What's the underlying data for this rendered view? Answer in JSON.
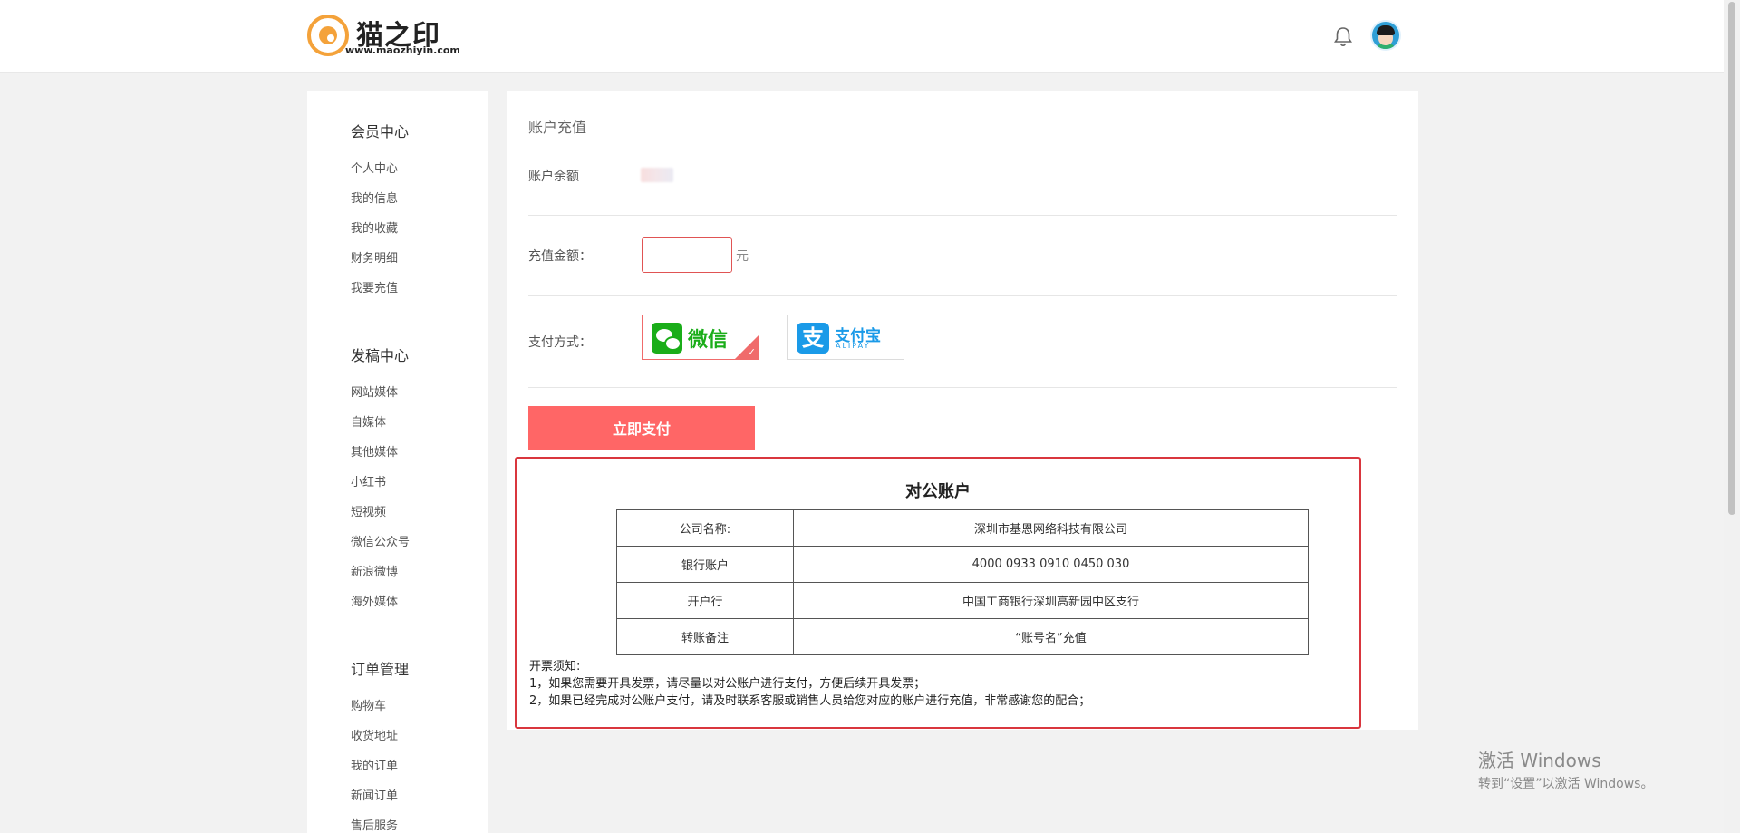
{
  "header": {
    "logo_title": "猫之印",
    "logo_url": "www.maozhiyin.com",
    "bell_icon": "bell-icon",
    "avatar_icon": "user-avatar"
  },
  "sidebar": {
    "groups": [
      {
        "title": "会员中心",
        "items": [
          "个人中心",
          "我的信息",
          "我的收藏",
          "财务明细",
          "我要充值"
        ]
      },
      {
        "title": "发稿中心",
        "items": [
          "网站媒体",
          "自媒体",
          "其他媒体",
          "小红书",
          "短视频",
          "微信公众号",
          "新浪微博",
          "海外媒体"
        ]
      },
      {
        "title": "订单管理",
        "items": [
          "购物车",
          "收货地址",
          "我的订单",
          "新闻订单",
          "售后服务"
        ]
      }
    ]
  },
  "recharge": {
    "title": "账户充值",
    "balance_label": "账户余额",
    "amount_label": "充值金额：",
    "amount_value": "",
    "amount_unit": "元",
    "method_label": "支付方式：",
    "wechat_label": "微信",
    "alipay_label": "支付宝",
    "alipay_sub": "ALIPAY",
    "selected_method": "微信",
    "pay_button": "立即支付"
  },
  "corporate": {
    "title": "对公账户",
    "rows": [
      {
        "key": "公司名称:",
        "value": "深圳市基恩网络科技有限公司"
      },
      {
        "key": "银行账户",
        "value": "4000 0933 0910 0450 030"
      },
      {
        "key": "开户行",
        "value": "中国工商银行深圳高新园中区支行"
      },
      {
        "key": "转账备注",
        "value": "“账号名”充值"
      }
    ],
    "notes_title": "开票须知:",
    "notes": [
      "1，如果您需要开具发票，请尽量以对公账户进行支付，方便后续开具发票；",
      "2，如果已经完成对公账户支付，请及时联系客服或销售人员给您对应的账户进行充值，非常感谢您的配合；"
    ]
  },
  "watermark": {
    "title": "激活 Windows",
    "subtitle": "转到“设置”以激活 Windows。"
  },
  "colors": {
    "accent": "#ff6666",
    "border_red": "#d9363e",
    "wechat_green": "#1aad19",
    "alipay_blue": "#1a9ae8"
  }
}
